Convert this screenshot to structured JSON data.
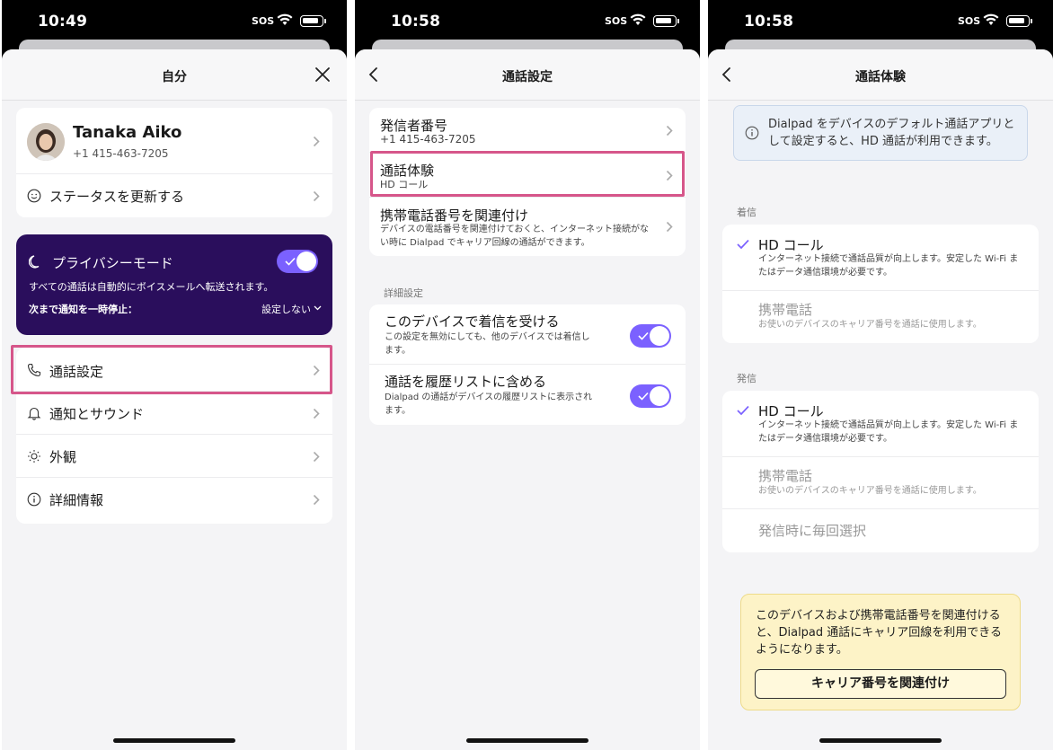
{
  "screens": [
    {
      "status": {
        "time": "10:49",
        "sos": "SOS"
      },
      "title": "自分",
      "profile": {
        "name": "Tanaka Aiko",
        "phone": "+1 415-463-7205"
      },
      "status_row": "ステータスを更新する",
      "privacy": {
        "title": "プライバシーモード",
        "description": "すべての通話は自動的にボイスメールへ転送されます。",
        "pause_label": "次まで通知を一時停止：",
        "pause_value": "設定しない",
        "enabled": true
      },
      "menu": [
        {
          "label": "通話設定",
          "icon": "phone-icon",
          "highlighted": true
        },
        {
          "label": "通知とサウンド",
          "icon": "bell-icon"
        },
        {
          "label": "外観",
          "icon": "sun-icon"
        },
        {
          "label": "詳細情報",
          "icon": "info-icon"
        }
      ]
    },
    {
      "status": {
        "time": "10:58",
        "sos": "SOS"
      },
      "title": "通話設定",
      "items": [
        {
          "title": "発信者番号",
          "sub": "+1 415-463-7205"
        },
        {
          "title": "通話体験",
          "sub": "HD コール",
          "highlighted": true
        },
        {
          "title": "携帯電話番号を関連付け",
          "sub": "デバイスの電話番号を関連付けておくと、インターネット接続がない時に Dialpad でキャリア回線の通話ができます。"
        }
      ],
      "advanced_label": "詳細設定",
      "advanced": [
        {
          "title": "このデバイスで着信を受ける",
          "sub": "この設定を無効にしても、他のデバイスでは着信します。",
          "enabled": true
        },
        {
          "title": "通話を履歴リストに含める",
          "sub": "Dialpad の通話がデバイスの履歴リストに表示されます。",
          "enabled": true
        }
      ]
    },
    {
      "status": {
        "time": "10:58",
        "sos": "SOS"
      },
      "title": "通話体験",
      "info": "Dialpad をデバイスのデフォルト通話アプリとして設定すると、HD 通話が利用できます。",
      "incoming_label": "着信",
      "incoming": [
        {
          "title": "HD コール",
          "sub": "インターネット接続で通話品質が向上します。安定した Wi-Fi またはデータ通信環境が必要です。",
          "selected": true
        },
        {
          "title": "携帯電話",
          "sub": "お使いのデバイスのキャリア番号を通話に使用します。",
          "selected": false
        }
      ],
      "outgoing_label": "発信",
      "outgoing": [
        {
          "title": "HD コール",
          "sub": "インターネット接続で通話品質が向上します。安定した Wi-Fi またはデータ通信環境が必要です。",
          "selected": true
        },
        {
          "title": "携帯電話",
          "sub": "お使いのデバイスのキャリア番号を通話に使用します。",
          "selected": false
        },
        {
          "title": "発信時に毎回選択",
          "selected": false
        }
      ],
      "carrier_note": "このデバイスおよび携帯電話番号を関連付けると、Dialpad 通話にキャリア回線を利用できるようになります。",
      "carrier_button": "キャリア番号を関連付け"
    }
  ],
  "colors": {
    "accent": "#7b61ff",
    "privacy_bg": "#2a0e5c",
    "highlight": "#d6568a",
    "note_bg": "#fdf3c7",
    "info_bg": "#eaf0f8"
  }
}
